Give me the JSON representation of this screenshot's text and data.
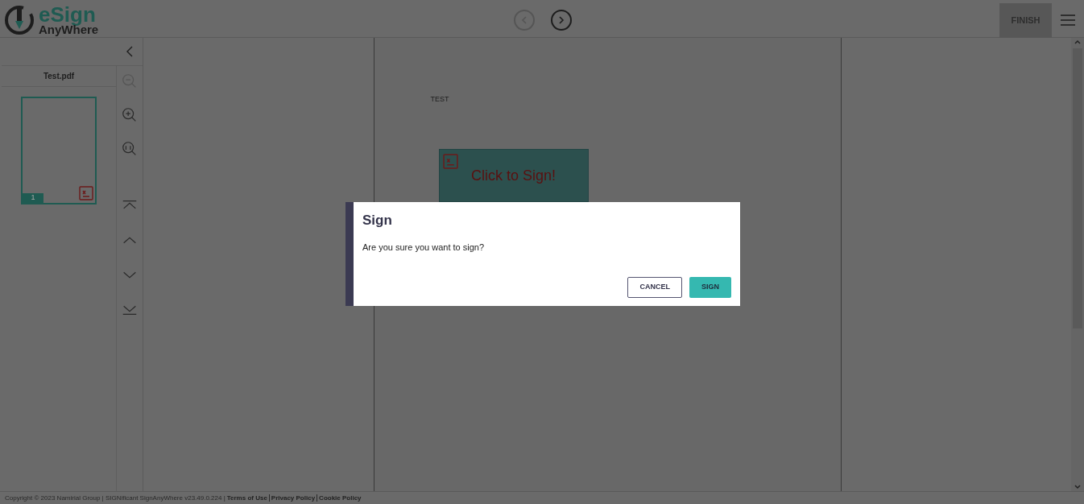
{
  "header": {
    "logo": {
      "line_1": "eSign",
      "line_2": "AnyWhere"
    },
    "nav": [
      {
        "kind": "previous",
        "disabled": true
      },
      {
        "kind": "next",
        "disabled": false
      }
    ],
    "finish_button": "FINISH"
  },
  "sidebar": {
    "file_name": "Test.pdf",
    "thumbnails": [
      {
        "page": "1",
        "selected": true
      }
    ]
  },
  "document": {
    "text": "TEST",
    "signature_field": {
      "label": "Click to Sign!"
    }
  },
  "dialog": {
    "title": "Sign",
    "message": "Are you sure you want to sign?",
    "buttons": [
      {
        "label": "CANCEL",
        "kind": "secondary"
      },
      {
        "label": "SIGN",
        "kind": "primary"
      }
    ]
  },
  "footer": {
    "copyright": "Copyright © 2023 Namirial Group | SIGNificant SignAnyWhere v23.49.0.224 |",
    "links": [
      "Terms of Use",
      "Privacy Policy",
      "Cookie Policy"
    ]
  }
}
